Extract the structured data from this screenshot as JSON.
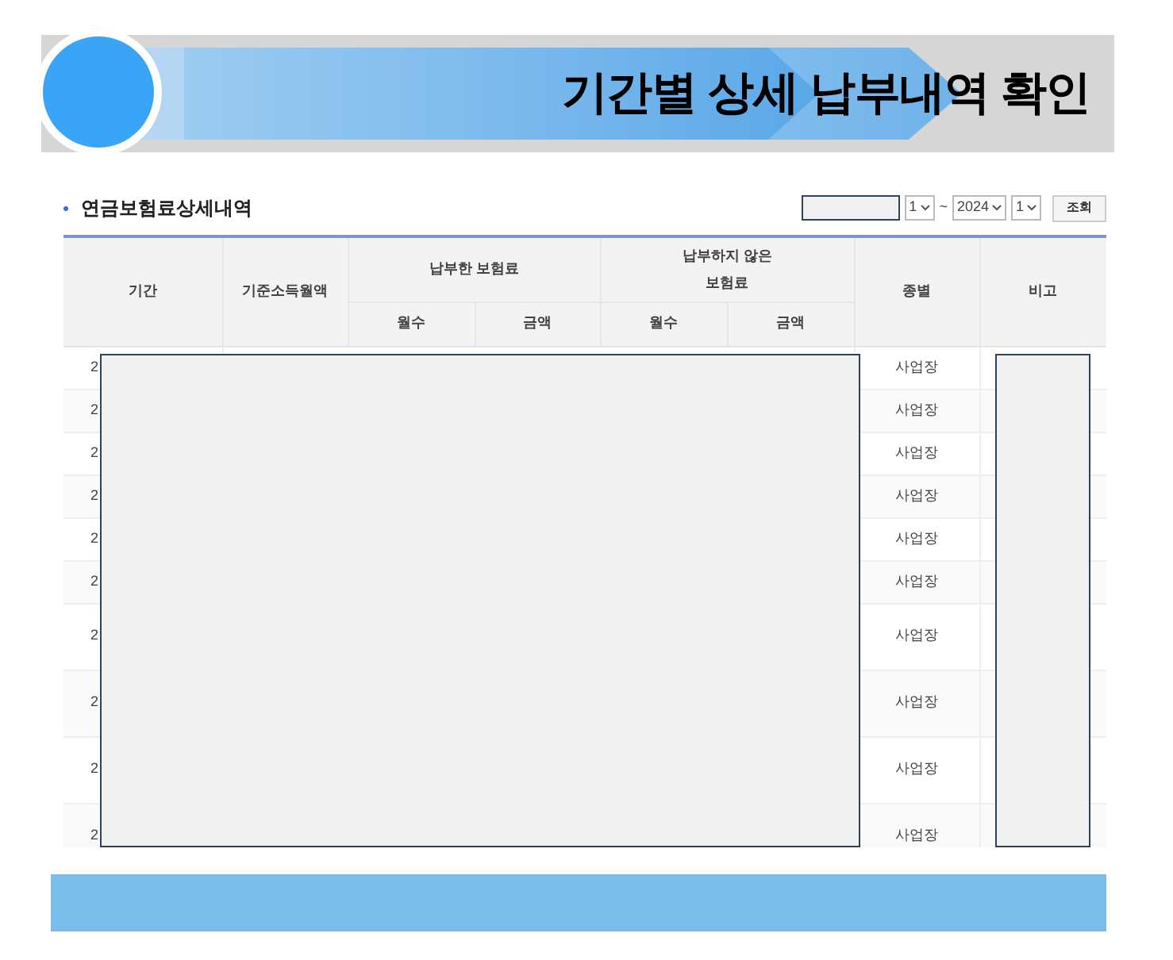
{
  "banner": {
    "title": "기간별 상세 납부내역 확인"
  },
  "section": {
    "title": "연금보험료상세내역"
  },
  "filter": {
    "selects": [
      "1",
      "2024",
      "1"
    ],
    "separator": "~",
    "button": "조회"
  },
  "table": {
    "columns": [
      {
        "label": "기간"
      },
      {
        "label": "기준소득월액"
      },
      {
        "label": "납부한 보험료",
        "children": [
          "월수",
          "금액"
        ]
      },
      {
        "label": "납부하지 않은\n보험료",
        "children": [
          "월수",
          "금액"
        ]
      },
      {
        "label": "종별"
      },
      {
        "label": "비고"
      }
    ],
    "rows": [
      {
        "period": "2",
        "type": "사업장"
      },
      {
        "period": "2",
        "type": "사업장"
      },
      {
        "period": "2",
        "type": "사업장"
      },
      {
        "period": "2",
        "type": "사업장"
      },
      {
        "period": "2",
        "type": "사업장"
      },
      {
        "period": "2",
        "type": "사업장"
      },
      {
        "period": "2",
        "type": "사업장"
      },
      {
        "period": "2",
        "type": "사업장"
      },
      {
        "period": "2",
        "type": "사업장"
      },
      {
        "period": "2",
        "type": "사업장"
      }
    ]
  }
}
